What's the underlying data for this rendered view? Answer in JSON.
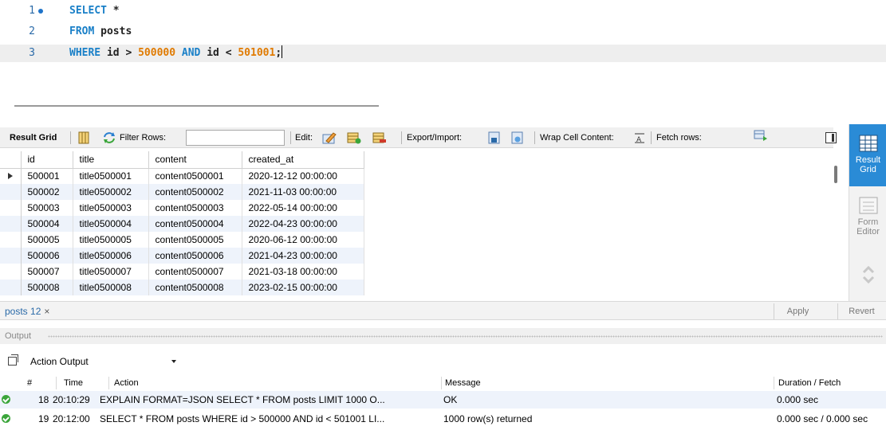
{
  "editor": {
    "lines": [
      {
        "num": "1",
        "keyword": "SELECT",
        "rest": " *"
      },
      {
        "num": "2",
        "keyword": "FROM",
        "rest": " posts"
      },
      {
        "num": "3",
        "kw1": "WHERE",
        "t1": " id > ",
        "n1": "500000",
        "kw2": " AND",
        "t2": " id < ",
        "n2": "501001",
        "end": ";"
      }
    ]
  },
  "toolbar": {
    "result_grid": "Result Grid",
    "filter_rows": "Filter Rows:",
    "filter_value": "",
    "edit": "Edit:",
    "export_import": "Export/Import:",
    "wrap_cell": "Wrap Cell Content:",
    "fetch_rows": "Fetch rows:"
  },
  "grid": {
    "columns": [
      "id",
      "title",
      "content",
      "created_at"
    ],
    "rows": [
      [
        "500001",
        "title0500001",
        "content0500001",
        "2020-12-12 00:00:00"
      ],
      [
        "500002",
        "title0500002",
        "content0500002",
        "2021-11-03 00:00:00"
      ],
      [
        "500003",
        "title0500003",
        "content0500003",
        "2022-05-14 00:00:00"
      ],
      [
        "500004",
        "title0500004",
        "content0500004",
        "2022-04-23 00:00:00"
      ],
      [
        "500005",
        "title0500005",
        "content0500005",
        "2020-06-12 00:00:00"
      ],
      [
        "500006",
        "title0500006",
        "content0500006",
        "2021-04-23 00:00:00"
      ],
      [
        "500007",
        "title0500007",
        "content0500007",
        "2021-03-18 00:00:00"
      ],
      [
        "500008",
        "title0500008",
        "content0500008",
        "2023-02-15 00:00:00"
      ]
    ]
  },
  "side_panel": {
    "result_grid": "Result Grid",
    "form_editor": "Form Editor"
  },
  "tabs": {
    "active": "posts 12",
    "close": "×",
    "apply": "Apply",
    "revert": "Revert"
  },
  "output": {
    "title": "Output",
    "selector": "Action Output",
    "headers": {
      "num": "#",
      "time": "Time",
      "action": "Action",
      "message": "Message",
      "duration": "Duration / Fetch"
    },
    "rows": [
      {
        "num": "18",
        "time": "20:10:29",
        "action": "EXPLAIN FORMAT=JSON SELECT * FROM posts  LIMIT 1000 O...",
        "message": "OK",
        "duration": "0.000 sec"
      },
      {
        "num": "19",
        "time": "20:12:00",
        "action": "SELECT * FROM posts  WHERE id > 500000 AND id < 501001 LI...",
        "message": "1000 row(s) returned",
        "duration": "0.000 sec / 0.000 sec"
      }
    ]
  },
  "colors": {
    "keyword": "#1a80c8",
    "number": "#e07a00",
    "accent": "#2a8bd6",
    "ok": "#3aa53a",
    "alt_row": "#eef3fb"
  }
}
